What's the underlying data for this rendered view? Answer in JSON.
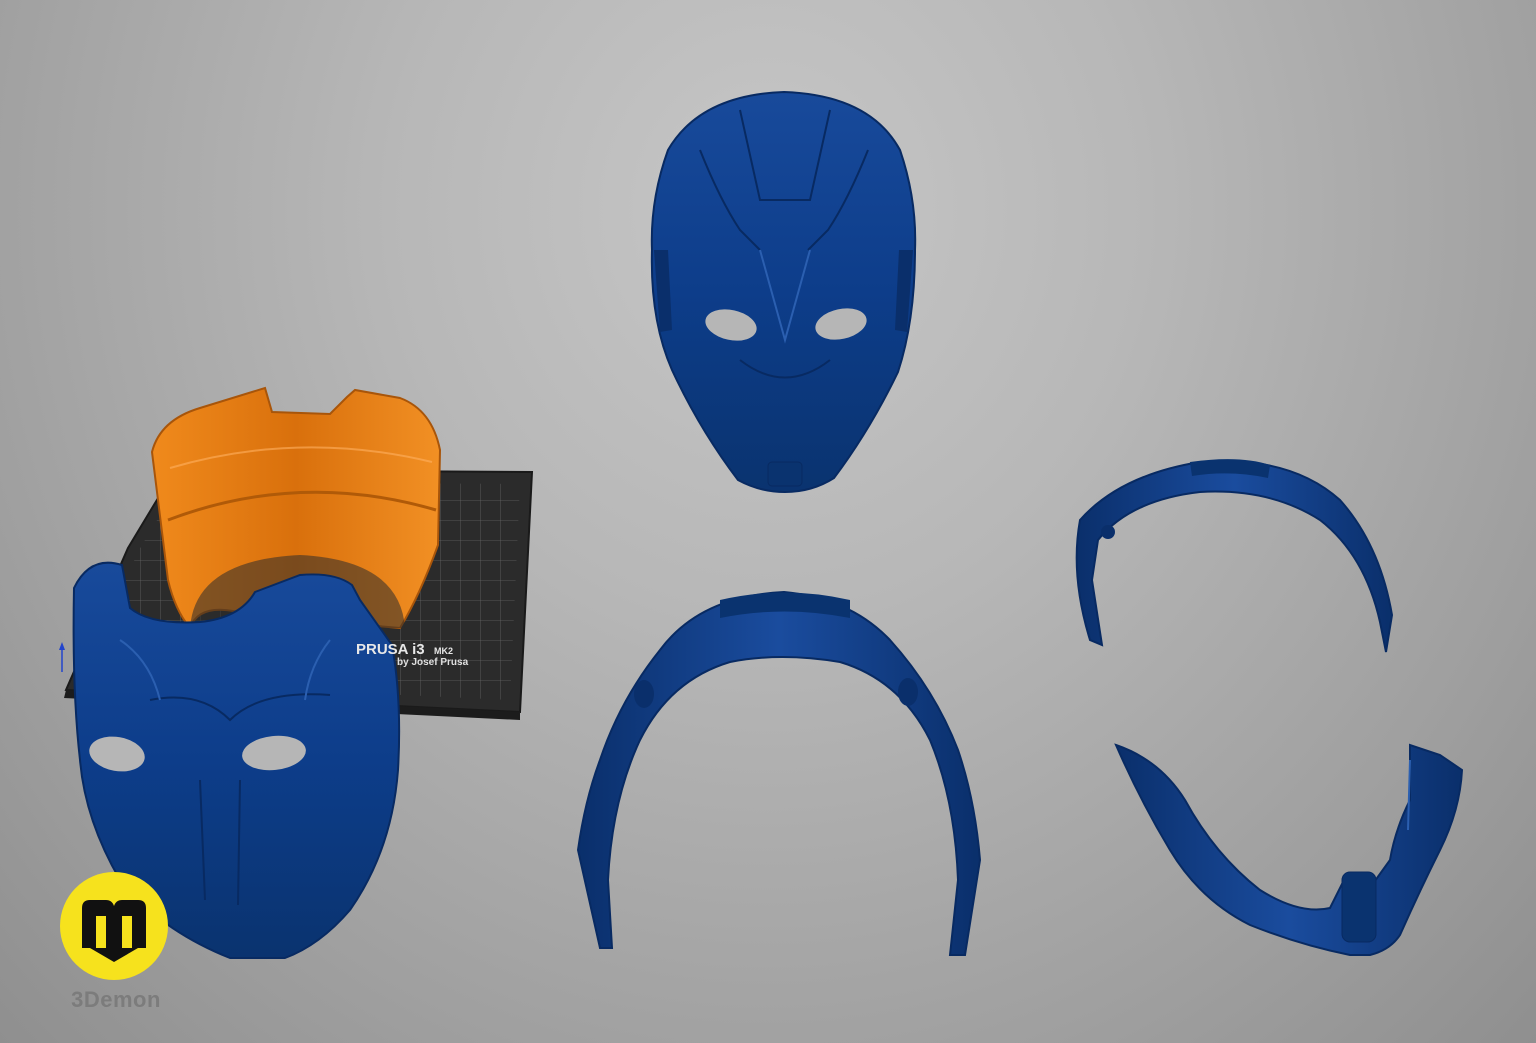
{
  "print_bed": {
    "label": "PRUSA i3",
    "model": "MK2",
    "maker": "by Josef Prusa"
  },
  "brand": {
    "name": "3Demon",
    "logo_color": "#f6e21d"
  },
  "colors": {
    "mask_part": "#0d3d8a",
    "mask_part_shadow": "#082a62",
    "mask_part_highlight": "#2b5fb0",
    "highlighted_part": "#e87d10",
    "print_bed": "#2b2b2b",
    "background": "#b7b7b7"
  },
  "icons": {
    "logo": "3demon-logo-icon",
    "axis": "axis-gizmo-icon"
  }
}
